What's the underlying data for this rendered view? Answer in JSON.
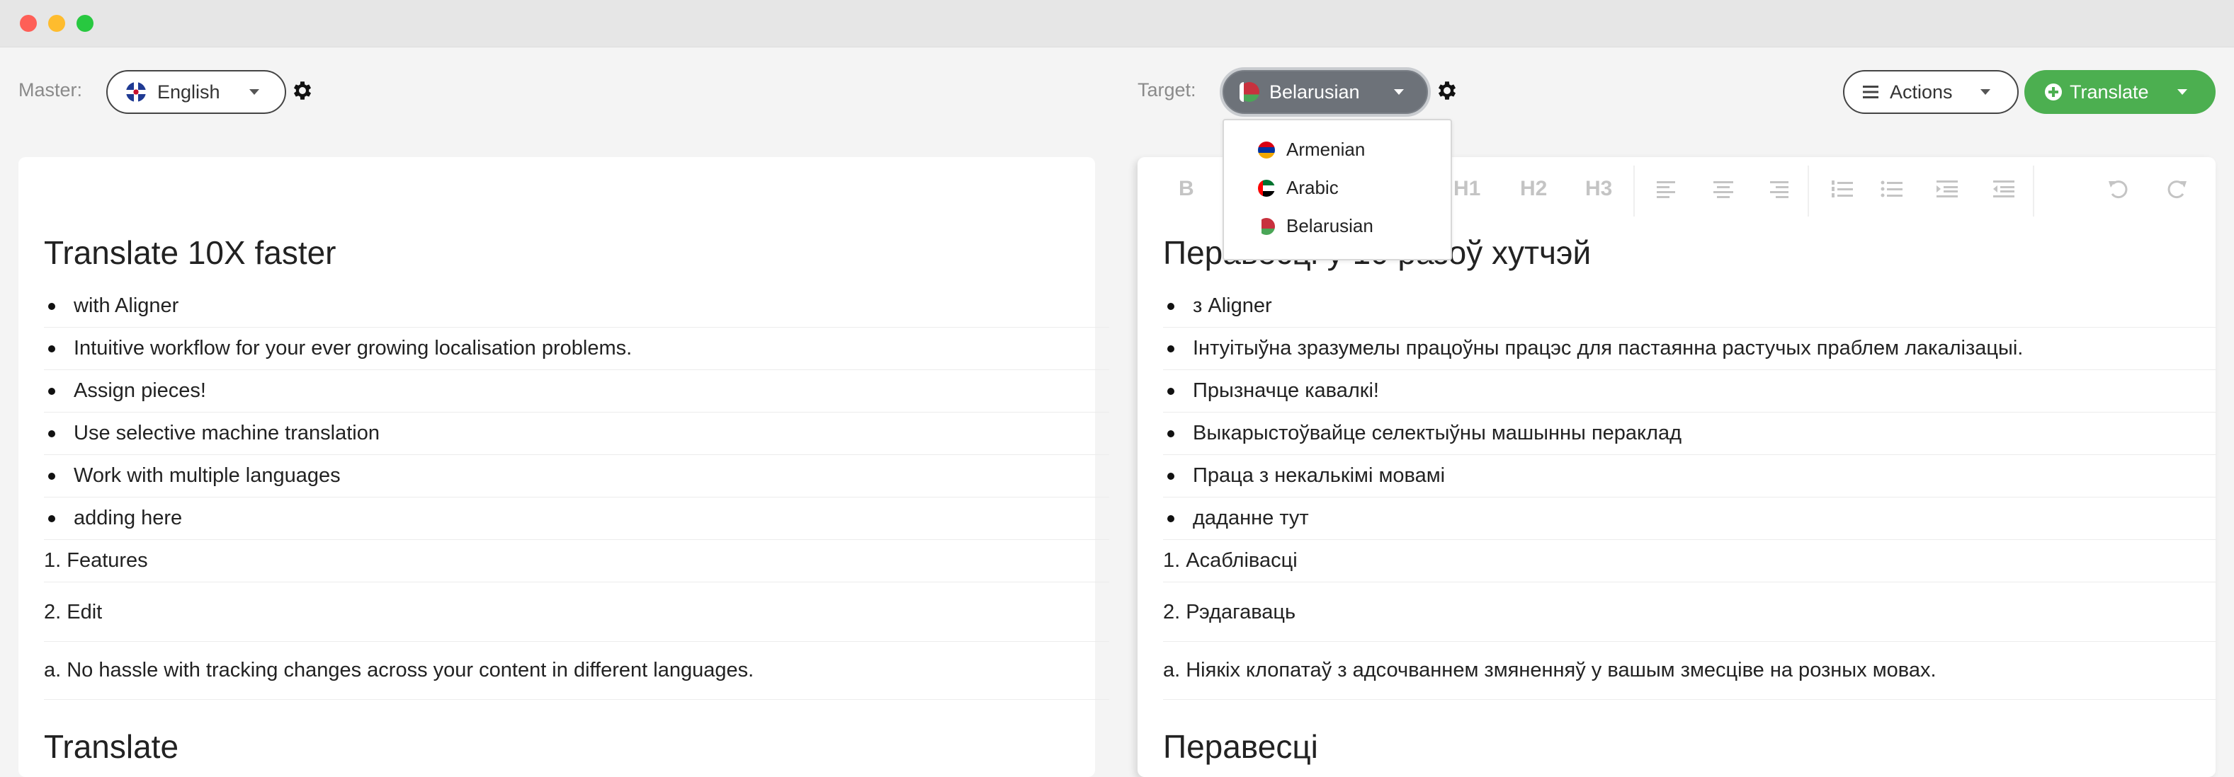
{
  "window": {
    "buttons": [
      "close",
      "minimize",
      "maximize"
    ]
  },
  "toolbar": {
    "master_label": "Master:",
    "master_language": "English",
    "target_label": "Target:",
    "target_language": "Belarusian",
    "actions_label": "Actions",
    "translate_label": "Translate"
  },
  "dropdown": {
    "items": [
      "Armenian",
      "Arabic",
      "Belarusian"
    ]
  },
  "editor_toolbar": {
    "bold": "B",
    "h1": "H1",
    "h2": "H2",
    "h3": "H3"
  },
  "master": {
    "heading1": "Translate 10X faster",
    "bullets": [
      "with Aligner",
      "Intuitive workflow for your ever growing localisation problems.",
      "Assign pieces!",
      "Use selective machine translation",
      "Work with multiple languages",
      "adding here"
    ],
    "item1": "1. Features",
    "item2": "2. Edit",
    "item3": "a. No hassle with tracking changes across your content in different languages.",
    "heading2": "Translate"
  },
  "target": {
    "heading1": "Перавесці у 10 разоў хутчэй",
    "bullets": [
      "з Aligner",
      "Інтуітыўна зразумелы працоўны працэс для пастаянна растучых праблем лакалізацыі.",
      "Прызначце кавалкі!",
      "Выкарыстоўвайце селектыўны машынны пераклад",
      "Праца з некалькімі мовамі",
      "даданне тут"
    ],
    "item1": "1. Асаблівасці",
    "item2": "2. Рэдагаваць",
    "item3": "а. Ніякіх клопатаў з адсочваннем змяненняў у вашым змесціве на розных мовах.",
    "heading2": "Перавесці"
  },
  "colors": {
    "accent_green": "#4caf50",
    "target_select_bg": "#6d7279"
  }
}
